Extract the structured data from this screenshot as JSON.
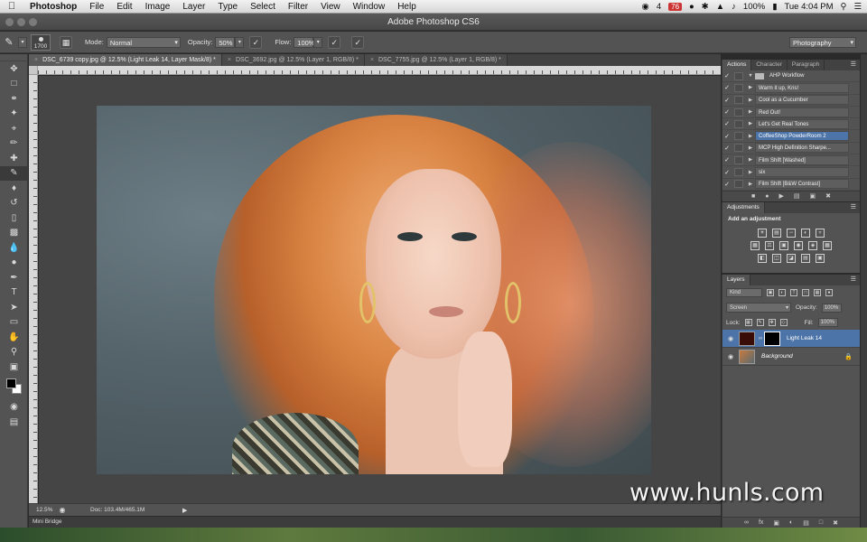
{
  "menubar": {
    "app": "Photoshop",
    "items": [
      "File",
      "Edit",
      "Image",
      "Layer",
      "Type",
      "Select",
      "Filter",
      "View",
      "Window",
      "Help"
    ],
    "status": {
      "notif": "4",
      "red_badge": "76",
      "battery": "100%",
      "clock": "Tue 4:04 PM"
    }
  },
  "window": {
    "title": "Adobe Photoshop CS6"
  },
  "options_bar": {
    "brush_size": "1700",
    "mode_label": "Mode:",
    "mode_value": "Normal",
    "opacity_label": "Opacity:",
    "opacity_value": "50%",
    "flow_label": "Flow:",
    "flow_value": "100%",
    "workspace": "Photography"
  },
  "doc_tabs": [
    {
      "label": "DSC_6739 copy.jpg @ 12.5% (Light Leak 14, Layer Mask/8) *",
      "active": true
    },
    {
      "label": "DSC_3692.jpg @ 12.5% (Layer 1, RGB/8) *",
      "active": false
    },
    {
      "label": "DSC_7755.jpg @ 12.5% (Layer 1, RGB/8) *",
      "active": false
    }
  ],
  "status_bar": {
    "zoom": "12.5%",
    "doc": "Doc: 103.4M/465.1M"
  },
  "mini_bridge": "Mini Bridge",
  "actions_panel": {
    "tabs": [
      "Actions",
      "Character",
      "Paragraph"
    ],
    "group": "AHP Workflow",
    "items": [
      {
        "name": "Warm it up, Kris!",
        "selected": false
      },
      {
        "name": "Cool as a Cucumber",
        "selected": false
      },
      {
        "name": "Red Out!",
        "selected": false
      },
      {
        "name": "Let's Get Real Tones",
        "selected": false
      },
      {
        "name": "CoffeeShop PowderRoom 2",
        "selected": true
      },
      {
        "name": "MCP High Definition Sharpe...",
        "selected": false
      },
      {
        "name": "Film Shift [Washed]",
        "selected": false
      },
      {
        "name": "six",
        "selected": false
      },
      {
        "name": "Film Shift [B&W Contrast]",
        "selected": false
      }
    ]
  },
  "adjustments_panel": {
    "tab": "Adjustments",
    "title": "Add an adjustment"
  },
  "layers_panel": {
    "tab": "Layers",
    "kind": "Kind",
    "blend_mode": "Screen",
    "opacity_label": "Opacity:",
    "opacity_value": "100%",
    "lock_label": "Lock:",
    "fill_label": "Fill:",
    "fill_value": "100%",
    "layers": [
      {
        "name": "Light Leak 14",
        "selected": true
      },
      {
        "name": "Background",
        "selected": false
      }
    ]
  },
  "watermark": "www.hunls.com"
}
